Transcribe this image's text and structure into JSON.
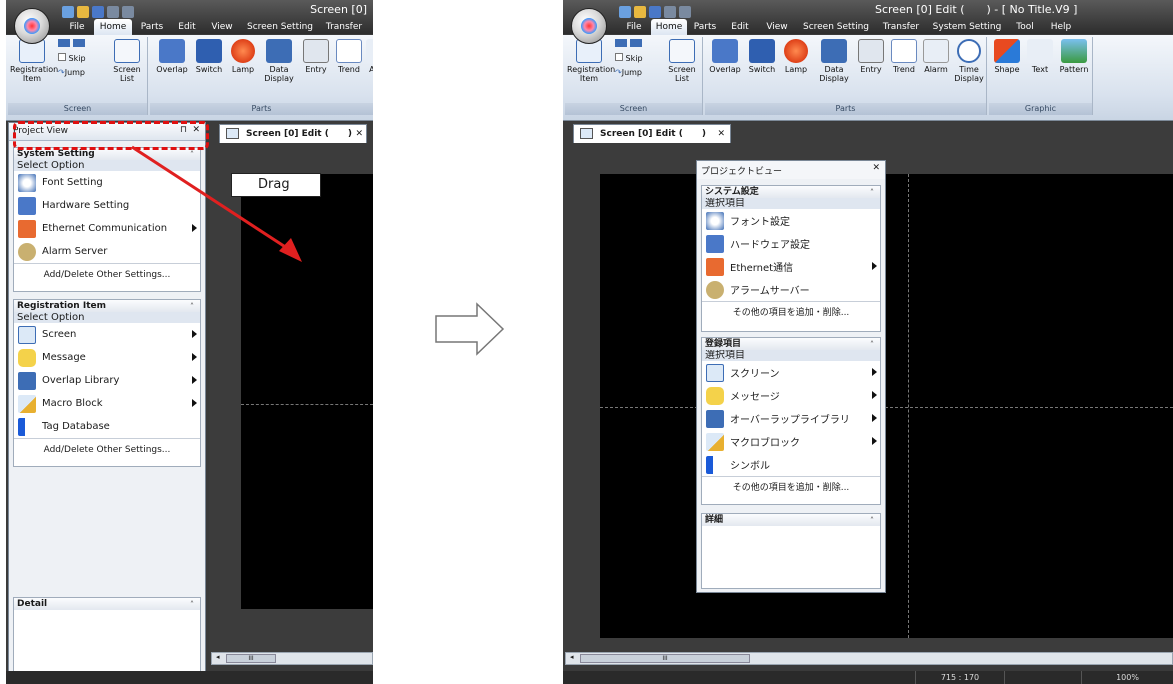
{
  "left": {
    "title": "Screen [0]",
    "menu": [
      "File",
      "Home",
      "Parts",
      "Edit",
      "View",
      "Screen Setting",
      "Transfer"
    ],
    "ribbon": {
      "registration_item": "Registration Item",
      "skip": "Skip",
      "jump": "Jump",
      "screen_list": "Screen List",
      "screen_group": "Screen",
      "overlap": "Overlap",
      "switch": "Switch",
      "lamp": "Lamp",
      "data_display": "Data Display",
      "entry": "Entry",
      "trend": "Trend",
      "alarm_cut": "Al",
      "parts_group": "Parts"
    },
    "project_view": {
      "title": "Project View",
      "system_setting": {
        "header": "System Setting",
        "select": "Select Option",
        "items": [
          "Font Setting",
          "Hardware Setting",
          "Ethernet Communication",
          "Alarm Server"
        ],
        "add": "Add/Delete Other Settings..."
      },
      "registration": {
        "header": "Registration Item",
        "select": "Select Option",
        "items": [
          "Screen",
          "Message",
          "Overlap Library",
          "Macro Block",
          "Tag Database"
        ],
        "add": "Add/Delete Other Settings..."
      },
      "detail": "Detail"
    },
    "doc_tab": "Screen [0] Edit (",
    "drag_label": "Drag",
    "scroll_mark": "III"
  },
  "right": {
    "title": "Screen [0] Edit (",
    "title_suffix": ") - [ No Title.V9 ]",
    "menu": [
      "File",
      "Home",
      "Parts",
      "Edit",
      "View",
      "Screen Setting",
      "Transfer",
      "System Setting",
      "Tool",
      "Help"
    ],
    "ribbon": {
      "registration_item": "Registration Item",
      "skip": "Skip",
      "jump": "Jump",
      "screen_list": "Screen List",
      "screen_group": "Screen",
      "overlap": "Overlap",
      "switch": "Switch",
      "lamp": "Lamp",
      "data_display": "Data Display",
      "entry": "Entry",
      "trend": "Trend",
      "alarm": "Alarm",
      "time_display": "Time Display",
      "parts_group": "Parts",
      "shape": "Shape",
      "text": "Text",
      "pattern": "Pattern",
      "graphic_group": "Graphic"
    },
    "doc_tab": "Screen [0] Edit (",
    "doc_tab_end": ")",
    "project_view": {
      "title": "プロジェクトビュー",
      "system_setting": {
        "header": "システム設定",
        "select": "選択項目",
        "items": [
          "フォント設定",
          "ハードウェア設定",
          "Ethernet通信",
          "アラームサーバー"
        ],
        "add": "その他の項目を追加・削除..."
      },
      "registration": {
        "header": "登録項目",
        "select": "選択項目",
        "items": [
          "スクリーン",
          "メッセージ",
          "オーバーラップライブラリ",
          "マクロブロック",
          "シンボル"
        ],
        "add": "その他の項目を追加・削除..."
      },
      "detail": "詳細"
    },
    "status_coords": "715 : 170",
    "status_zoom": "100%",
    "scroll_mark": "III"
  },
  "colors": {
    "accent_red": "#e01010",
    "drag_arrow": "#e02020"
  }
}
